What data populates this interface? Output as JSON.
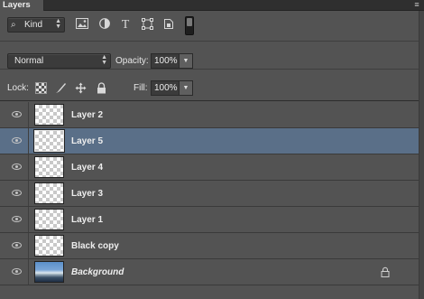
{
  "panel": {
    "title": "Layers",
    "flyout_glyph": "≡"
  },
  "filter": {
    "kind_label": "Kind",
    "search_icon": "⌕",
    "icons": [
      "image-filter-icon",
      "adjustment-filter-icon",
      "type-filter-icon",
      "shape-filter-icon",
      "smart-object-filter-icon"
    ],
    "type_glyph": "T"
  },
  "blend": {
    "mode": "Normal",
    "opacity_label": "Opacity:",
    "opacity_value": "100%"
  },
  "lock": {
    "label": "Lock:",
    "fill_label": "Fill:",
    "fill_value": "100%"
  },
  "layers": [
    {
      "name": "Layer 2",
      "visible": true,
      "selected": false
    },
    {
      "name": "Layer 5",
      "visible": true,
      "selected": true
    },
    {
      "name": "Layer 4",
      "visible": true,
      "selected": false
    },
    {
      "name": "Layer 3",
      "visible": true,
      "selected": false
    },
    {
      "name": "Layer 1",
      "visible": true,
      "selected": false
    },
    {
      "name": "Black copy",
      "visible": true,
      "selected": false
    },
    {
      "name": "Background",
      "visible": true,
      "selected": false,
      "locked": true
    }
  ],
  "colors": {
    "panel": "#535353",
    "selected_row": "#5a6f88"
  }
}
